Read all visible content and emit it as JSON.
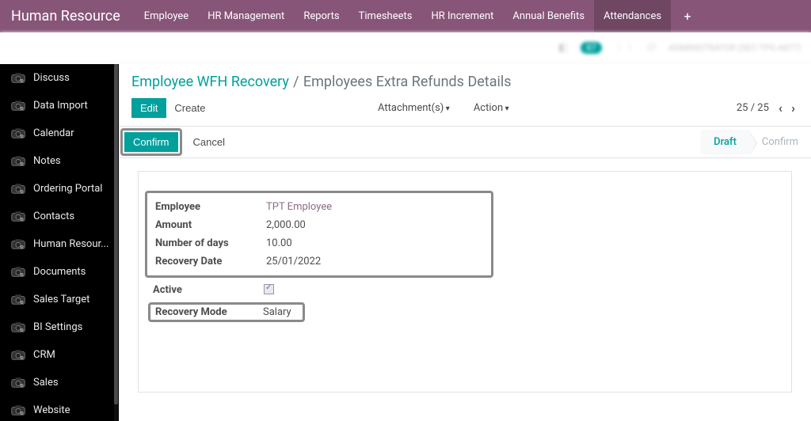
{
  "brand": "Human Resource",
  "topnav": {
    "items": [
      {
        "label": "Employee"
      },
      {
        "label": "HR Management"
      },
      {
        "label": "Reports"
      },
      {
        "label": "Timesheets"
      },
      {
        "label": "HR Increment"
      },
      {
        "label": "Annual Benefits"
      },
      {
        "label": "Attendances",
        "active": true
      }
    ]
  },
  "subheader": {
    "badge": "87",
    "user_text": "ADMINISTRATOR (SEC-TPG-A877)"
  },
  "sidebar": {
    "items": [
      {
        "label": "Discuss"
      },
      {
        "label": "Data Import"
      },
      {
        "label": "Calendar"
      },
      {
        "label": "Notes"
      },
      {
        "label": "Ordering Portal"
      },
      {
        "label": "Contacts"
      },
      {
        "label": "Human Resour..."
      },
      {
        "label": "Documents"
      },
      {
        "label": "Sales Target"
      },
      {
        "label": "BI Settings"
      },
      {
        "label": "CRM"
      },
      {
        "label": "Sales"
      },
      {
        "label": "Website"
      }
    ]
  },
  "breadcrumb": {
    "root": "Employee WFH Recovery",
    "sep": "/",
    "current": "Employees Extra Refunds Details"
  },
  "toolbar": {
    "edit": "Edit",
    "create": "Create",
    "attachments": "Attachment(s)",
    "action": "Action",
    "pager": "25 / 25"
  },
  "statusbar": {
    "confirm": "Confirm",
    "cancel": "Cancel",
    "stages": {
      "draft": "Draft",
      "confirm": "Confirm"
    }
  },
  "form": {
    "employee_label": "Employee",
    "employee_value": "TPT Employee",
    "amount_label": "Amount",
    "amount_value": "2,000.00",
    "days_label": "Number of days",
    "days_value": "10.00",
    "date_label": "Recovery Date",
    "date_value": "25/01/2022",
    "active_label": "Active",
    "active_checked": true,
    "mode_label": "Recovery Mode",
    "mode_value": "Salary"
  }
}
